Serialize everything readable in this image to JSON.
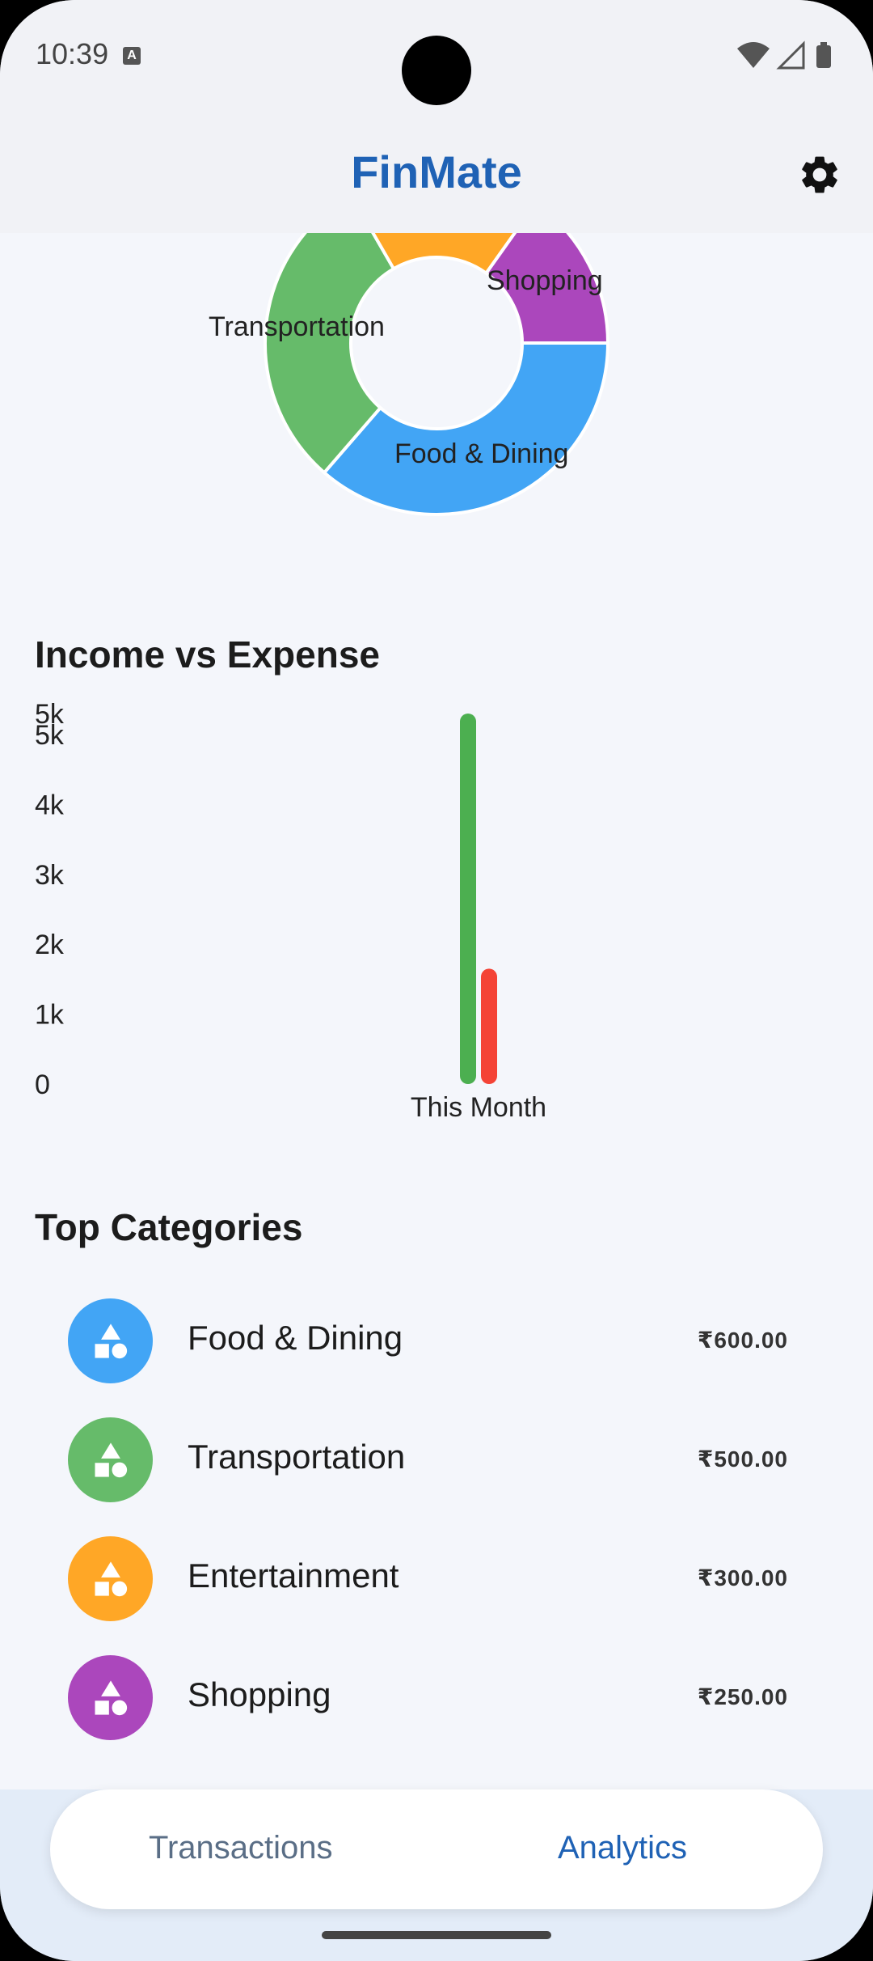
{
  "status_bar": {
    "time": "10:39",
    "notification_icon": "a-box-icon",
    "icons": [
      "wifi-icon",
      "signal-icon",
      "battery-icon"
    ]
  },
  "app_bar": {
    "title": "FinMate",
    "settings_icon": "gear-icon"
  },
  "donut": {
    "segments": [
      {
        "label": "Food & Dining",
        "value": 600,
        "color": "#42a5f5"
      },
      {
        "label": "Transportation",
        "value": 500,
        "color": "#66bb6a"
      },
      {
        "label": "Entertainment",
        "value": 300,
        "color": "#ffa726"
      },
      {
        "label": "Shopping",
        "value": 250,
        "color": "#ab47bc"
      }
    ],
    "visible_labels": {
      "shopping": "Shopping",
      "transportation": "Transportation",
      "food": "Food & Dining"
    }
  },
  "income_vs_expense": {
    "title": "Income vs Expense",
    "chart_data": {
      "type": "bar",
      "title": "Income vs Expense",
      "categories": [
        "This Month"
      ],
      "series": [
        {
          "values": [
            5300
          ],
          "color": "#4caf50"
        },
        {
          "values": [
            1650
          ],
          "color": "#f44336"
        }
      ],
      "y_ticks": [
        "0",
        "1k",
        "2k",
        "3k",
        "4k",
        "5k",
        "5k"
      ],
      "ylim": [
        0,
        5300
      ],
      "grid": false
    }
  },
  "top_categories": {
    "title": "Top Categories",
    "items": [
      {
        "name": "Food & Dining",
        "amount": "₹600.00",
        "color": "#42a5f5",
        "icon": "category-shapes-icon"
      },
      {
        "name": "Transportation",
        "amount": "₹500.00",
        "color": "#66bb6a",
        "icon": "category-shapes-icon"
      },
      {
        "name": "Entertainment",
        "amount": "₹300.00",
        "color": "#ffa726",
        "icon": "category-shapes-icon"
      },
      {
        "name": "Shopping",
        "amount": "₹250.00",
        "color": "#ab47bc",
        "icon": "category-shapes-icon"
      }
    ]
  },
  "bottom_nav": {
    "tabs": [
      {
        "label": "Transactions",
        "active": false
      },
      {
        "label": "Analytics",
        "active": true
      }
    ]
  },
  "colors": {
    "accent": "#1f62b5",
    "background": "#f4f6fb"
  }
}
